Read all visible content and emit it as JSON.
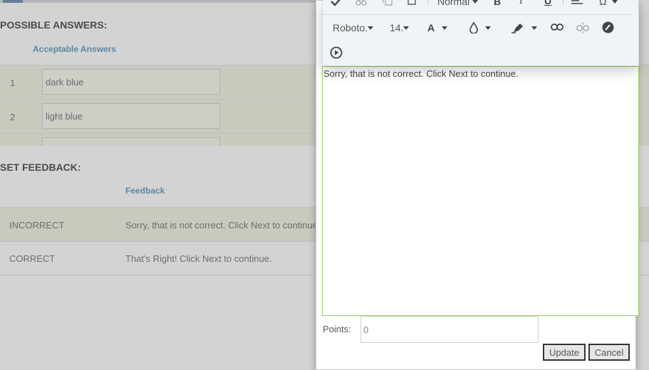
{
  "possible_answers": {
    "title": "POSSIBLE ANSWERS:",
    "column_header": "Acceptable Answers",
    "rows": [
      {
        "num": "1",
        "value": "dark blue"
      },
      {
        "num": "2",
        "value": "light blue"
      },
      {
        "num": "",
        "value": ""
      }
    ]
  },
  "set_feedback": {
    "title": "SET FEEDBACK:",
    "column_header": "Feedback",
    "rows": [
      {
        "label": "INCORRECT",
        "feedback": "Sorry, that is not correct.  Click Next to continue."
      },
      {
        "label": "CORRECT",
        "feedback": "That's Right!  Click Next to continue."
      }
    ]
  },
  "toolbar": {
    "format_value": "Normal",
    "font_family": "Roboto.",
    "font_size": "14.",
    "font_color_letter": "A",
    "icons": [
      "spellcheck-icon",
      "cut-icon",
      "copy-icon",
      "paste-icon",
      "bold-icon",
      "italic-icon",
      "underline-icon",
      "align-icon",
      "omega-icon",
      "text-color-icon",
      "fill-color-icon",
      "highlight-icon",
      "link-icon",
      "unlink-icon",
      "source-icon",
      "media-icon"
    ]
  },
  "editor": {
    "content": "Sorry, that is not correct.  Click Next to continue."
  },
  "points": {
    "label": "Points:",
    "value": "0"
  },
  "buttons": {
    "update": "Update",
    "cancel": "Cancel"
  },
  "colors": {
    "accent_blue": "#4f8db7",
    "editor_border": "#9ccc65",
    "row_highlight": "#eef3e0"
  }
}
